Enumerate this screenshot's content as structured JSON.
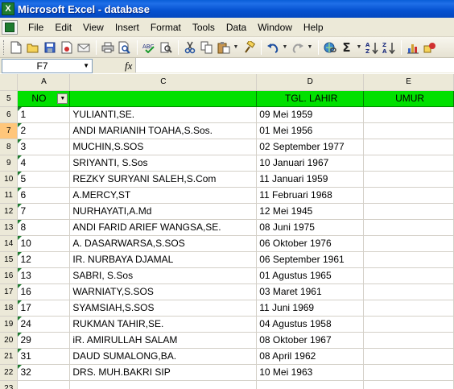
{
  "window": {
    "title": "Microsoft Excel - database"
  },
  "menu": {
    "items": [
      "File",
      "Edit",
      "View",
      "Insert",
      "Format",
      "Tools",
      "Data",
      "Window",
      "Help"
    ]
  },
  "toolbar": {
    "icons": [
      "new-icon",
      "open-icon",
      "save-icon",
      "permission-icon",
      "email-icon",
      "print-icon",
      "print-preview-icon",
      "spelling-icon",
      "research-icon",
      "cut-icon",
      "copy-icon",
      "paste-icon",
      "format-painter-icon",
      "undo-icon",
      "redo-icon",
      "hyperlink-icon",
      "autosum-icon",
      "sort-ascending-icon",
      "sort-descending-icon",
      "chart-wizard-icon",
      "drawing-icon"
    ],
    "autosum_label": "Σ"
  },
  "formula_bar": {
    "name_box": "F7",
    "fx_label": "fx",
    "formula": ""
  },
  "sheet": {
    "columns": [
      "A",
      "C",
      "D",
      "E"
    ],
    "headers": {
      "no": "NO",
      "name": "",
      "birth": "TGL. LAHIR",
      "age": "UMUR"
    },
    "selected_row": "7",
    "rows": [
      {
        "row": "5"
      },
      {
        "row": "6",
        "no": "1",
        "name": "YULIANTI,SE.",
        "birth": "09 Mei 1959"
      },
      {
        "row": "7",
        "no": "2",
        "name": "ANDI MARIANIH TOAHA,S.Sos.",
        "birth": "01 Mei 1956"
      },
      {
        "row": "8",
        "no": "3",
        "name": "MUCHIN,S.SOS",
        "birth": "02 September 1977"
      },
      {
        "row": "9",
        "no": "4",
        "name": "SRIYANTI, S.Sos",
        "birth": "10 Januari 1967"
      },
      {
        "row": "10",
        "no": "5",
        "name": "REZKY SURYANI SALEH,S.Com",
        "birth": "11 Januari 1959"
      },
      {
        "row": "11",
        "no": "6",
        "name": "A.MERCY,ST",
        "birth": "11 Februari 1968"
      },
      {
        "row": "12",
        "no": "7",
        "name": "NURHAYATI,A.Md",
        "birth": "12 Mei 1945"
      },
      {
        "row": "13",
        "no": "8",
        "name": "ANDI FARID ARIEF WANGSA,SE.",
        "birth": "08 Juni 1975"
      },
      {
        "row": "14",
        "no": "10",
        "name": "A. DASARWARSA,S.SOS",
        "birth": "06 Oktober 1976"
      },
      {
        "row": "15",
        "no": "12",
        "name": "IR. NURBAYA DJAMAL",
        "birth": "06 September 1961"
      },
      {
        "row": "16",
        "no": "13",
        "name": "SABRI, S.Sos",
        "birth": "01 Agustus 1965"
      },
      {
        "row": "17",
        "no": "16",
        "name": "WARNIATY,S.SOS",
        "birth": "03 Maret 1961"
      },
      {
        "row": "18",
        "no": "17",
        "name": "SYAMSIAH,S.SOS",
        "birth": "11 Juni 1969"
      },
      {
        "row": "19",
        "no": "24",
        "name": "RUKMAN TAHIR,SE.",
        "birth": "04 Agustus 1958"
      },
      {
        "row": "20",
        "no": "29",
        "name": "iR. AMIRULLAH SALAM",
        "birth": "08 Oktober 1967"
      },
      {
        "row": "21",
        "no": "31",
        "name": "DAUD SUMALONG,BA.",
        "birth": "08 April 1962"
      },
      {
        "row": "22",
        "no": "32",
        "name": "DRS. MUH.BAKRI SIP",
        "birth": "10 Mei 1963"
      },
      {
        "row": "23"
      }
    ]
  },
  "colors": {
    "header_fill": "#00e000",
    "title_bar": "#0551d0",
    "selected_row_header": "#ffc67a"
  }
}
